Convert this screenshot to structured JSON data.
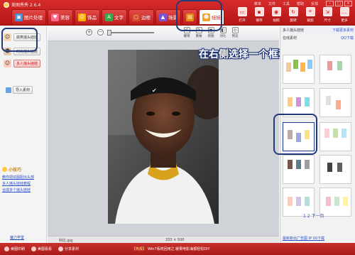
{
  "app": {
    "title": "美图秀秀 2.6.4"
  },
  "top_menu": [
    "菜单",
    "文件",
    "工具",
    "帮助",
    "反馈"
  ],
  "tabs": [
    {
      "label": "图片处理",
      "icon": "image-icon",
      "color": "#3f8fd8"
    },
    {
      "label": "美容",
      "icon": "heart-icon",
      "color": "#ff6b8a"
    },
    {
      "label": "饰品",
      "icon": "smile-icon",
      "color": "#ffb000"
    },
    {
      "label": "文字",
      "icon": "text-icon",
      "color": "#3aa84b"
    },
    {
      "label": "边框",
      "icon": "frame-icon",
      "color": "#d24b2b"
    },
    {
      "label": "场景",
      "icon": "scene-icon",
      "color": "#7b55d1"
    },
    {
      "label": "",
      "icon": "filmstrip-icon",
      "color": "#e38d19"
    },
    {
      "label": "娃娃",
      "icon": "doll-icon",
      "color": "#f0a42a"
    }
  ],
  "toolbar": [
    "打开",
    "保存",
    "拍照",
    "旋转",
    "裁剪",
    "尺寸",
    "更多"
  ],
  "left_panel": {
    "buttons": [
      {
        "label": "搞笑摇头娃娃",
        "icon": "man-icon",
        "active": false
      },
      {
        "label": "时尚摇头娃娃",
        "icon": "girl-icon",
        "active": false
      },
      {
        "label": "多人摇头娃娃",
        "icon": "couple-icon",
        "active": true
      }
    ],
    "import_label": "导入素材",
    "tips_title": "小技巧",
    "tips": [
      "教你把炫图配出头部",
      "多人摇头娃娃教程",
      "合成多个摇头娃娃"
    ],
    "class_link": "魔力学堂"
  },
  "canvas_toolbar": {
    "zoom_in": "+",
    "zoom_out": "−",
    "buttons": [
      "撤销",
      "重做",
      "原图",
      "对比",
      "预览"
    ]
  },
  "canvas": {
    "filename": "科比.jpg",
    "dimensions": "333 × 500"
  },
  "callout": "在右侧选择一个框架~",
  "right_panel": {
    "header": "多人摇头娃娃",
    "header_link": "下载更多素材",
    "online_label": "在线素材",
    "recommend_label": "QQ下载",
    "pager": "1 2 下一页",
    "ad": "最新新出广告图 IP 00下载"
  },
  "bottom_bar": {
    "items": [
      "美图印刷",
      "美图看看",
      "分享素材"
    ],
    "news_tag": "【热报】",
    "news_text": "Win7系统回用之 暖果电影海报轻松DIY"
  }
}
